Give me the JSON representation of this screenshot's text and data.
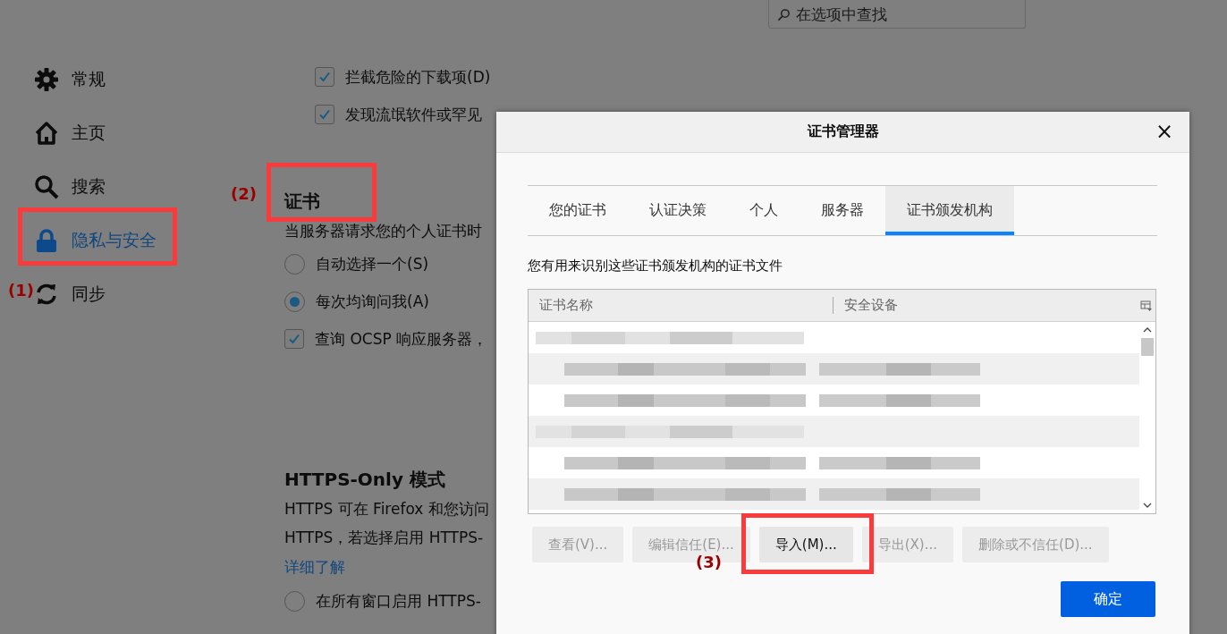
{
  "search": {
    "placeholder": "在选项中查找"
  },
  "sidebar": {
    "items": [
      {
        "kind": "gear",
        "label": "常规",
        "selected": false
      },
      {
        "kind": "home",
        "label": "主页",
        "selected": false
      },
      {
        "kind": "search",
        "label": "搜索",
        "selected": false
      },
      {
        "kind": "lock",
        "label": "隐私与安全",
        "selected": true
      },
      {
        "kind": "sync",
        "label": "同步",
        "selected": false
      }
    ]
  },
  "downloads": [
    {
      "label": "拦截危险的下载项(D)",
      "checked": true
    },
    {
      "label": "发现流氓软件或罕见",
      "checked": true
    }
  ],
  "certificates": {
    "heading": "证书",
    "description": "当服务器请求您的个人证书时",
    "options": [
      {
        "label": "自动选择一个(S)",
        "selected": false
      },
      {
        "label": "每次均询问我(A)",
        "selected": true
      }
    ],
    "ocsp": {
      "label": "查询 OCSP 响应服务器，",
      "checked": true
    }
  },
  "https_only": {
    "heading": "HTTPS-Only 模式",
    "lines": [
      "HTTPS 可在 Firefox 和您访问",
      "HTTPS，若选择启用 HTTPS-"
    ],
    "link": "详细了解",
    "options": [
      {
        "label": "在所有窗口启用 HTTPS-",
        "selected": false
      }
    ]
  },
  "dialog": {
    "title": "证书管理器",
    "close": "×",
    "tabs": [
      {
        "label": "您的证书",
        "selected": false
      },
      {
        "label": "认证决策",
        "selected": false
      },
      {
        "label": "个人",
        "selected": false
      },
      {
        "label": "服务器",
        "selected": false
      },
      {
        "label": "证书颁发机构",
        "selected": true
      }
    ],
    "description": "您有用来识别这些证书颁发机构的证书文件",
    "table": {
      "columns": [
        "证书名称",
        "安全设备"
      ],
      "rows": [
        {
          "kind": "group"
        },
        {
          "kind": "item"
        },
        {
          "kind": "item"
        },
        {
          "kind": "group"
        },
        {
          "kind": "item"
        },
        {
          "kind": "item"
        }
      ]
    },
    "buttons": [
      {
        "label": "查看(V)...",
        "disabled": true
      },
      {
        "label": "编辑信任(E)...",
        "disabled": true
      },
      {
        "label": "导入(M)...",
        "disabled": false
      },
      {
        "label": "导出(X)...",
        "disabled": true
      },
      {
        "label": "删除或不信任(D)...",
        "disabled": true
      }
    ],
    "ok": "确定"
  },
  "annotations": [
    {
      "label": "(1)"
    },
    {
      "label": "(2)"
    },
    {
      "label": "(3)"
    }
  ]
}
